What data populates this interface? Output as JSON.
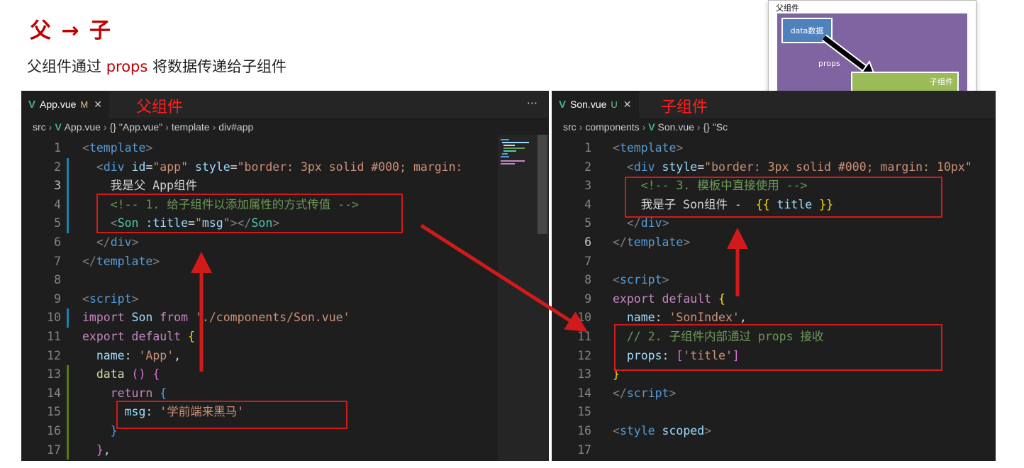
{
  "heading": "父 → 子",
  "subtitle": {
    "before": "父组件通过 ",
    "keyword": "props",
    "after": " 将数据传递给子组件"
  },
  "diagram": {
    "title": "父组件",
    "data_box": "data数据",
    "props_label": "props",
    "child_label": "子组件"
  },
  "left_editor": {
    "tab_file": "App.vue",
    "tab_status": "M",
    "tab_annotation": "父组件",
    "more": "···",
    "breadcrumb": [
      "src",
      "App.vue",
      "{} \"App.vue\"",
      "template",
      "div#app"
    ],
    "line_numbers": [
      "1",
      "2",
      "3",
      "4",
      "5",
      "6",
      "7",
      "8",
      "9",
      "10",
      "11",
      "12",
      "13",
      "14",
      "15",
      "16",
      "17"
    ],
    "lines": [
      [
        {
          "c": "t-br",
          "t": "<"
        },
        {
          "c": "t-tag",
          "t": "template"
        },
        {
          "c": "t-br",
          "t": ">"
        }
      ],
      [
        {
          "c": "t-txt",
          "t": "  "
        },
        {
          "c": "t-br",
          "t": "<"
        },
        {
          "c": "t-tag",
          "t": "div"
        },
        {
          "c": "t-attr",
          "t": " id"
        },
        {
          "c": "t-txt",
          "t": "="
        },
        {
          "c": "t-str",
          "t": "\"app\""
        },
        {
          "c": "t-attr",
          "t": " style"
        },
        {
          "c": "t-txt",
          "t": "="
        },
        {
          "c": "t-str",
          "t": "\"border: 3px solid #000; margin:"
        }
      ],
      [
        {
          "c": "t-txt",
          "t": "    我是父 App组件"
        }
      ],
      [
        {
          "c": "t-txt",
          "t": "    "
        },
        {
          "c": "t-com",
          "t": "<!-- 1. 给子组件以添加属性的方式传值 -->"
        }
      ],
      [
        {
          "c": "t-txt",
          "t": "    "
        },
        {
          "c": "t-br",
          "t": "<"
        },
        {
          "c": "t-comp",
          "t": "Son"
        },
        {
          "c": "t-attr",
          "t": " :title"
        },
        {
          "c": "t-txt",
          "t": "="
        },
        {
          "c": "t-str",
          "t": "\""
        },
        {
          "c": "t-var",
          "t": "msg"
        },
        {
          "c": "t-str",
          "t": "\""
        },
        {
          "c": "t-br",
          "t": "></"
        },
        {
          "c": "t-comp",
          "t": "Son"
        },
        {
          "c": "t-br",
          "t": ">"
        }
      ],
      [
        {
          "c": "t-txt",
          "t": "  "
        },
        {
          "c": "t-br",
          "t": "</"
        },
        {
          "c": "t-tag",
          "t": "div"
        },
        {
          "c": "t-br",
          "t": ">"
        }
      ],
      [
        {
          "c": "t-br",
          "t": "</"
        },
        {
          "c": "t-tag",
          "t": "template"
        },
        {
          "c": "t-br",
          "t": ">"
        }
      ],
      [],
      [
        {
          "c": "t-br",
          "t": "<"
        },
        {
          "c": "t-tag",
          "t": "script"
        },
        {
          "c": "t-br",
          "t": ">"
        }
      ],
      [
        {
          "c": "t-kw",
          "t": "import"
        },
        {
          "c": "t-var",
          "t": " Son"
        },
        {
          "c": "t-kw",
          "t": " from"
        },
        {
          "c": "t-str",
          "t": " './components/Son.vue'"
        }
      ],
      [
        {
          "c": "t-kw",
          "t": "export default"
        },
        {
          "c": "t-ylw",
          "t": " {"
        }
      ],
      [
        {
          "c": "t-var",
          "t": "  name"
        },
        {
          "c": "t-txt",
          "t": ": "
        },
        {
          "c": "t-str",
          "t": "'App'"
        },
        {
          "c": "t-txt",
          "t": ","
        }
      ],
      [
        {
          "c": "t-fn",
          "t": "  data"
        },
        {
          "c": "t-brk2",
          "t": " ()"
        },
        {
          "c": "t-brk2",
          "t": " {"
        }
      ],
      [
        {
          "c": "t-kw",
          "t": "    return"
        },
        {
          "c": "t-blue",
          "t": " {"
        }
      ],
      [
        {
          "c": "t-var",
          "t": "      msg"
        },
        {
          "c": "t-txt",
          "t": ": "
        },
        {
          "c": "t-str",
          "t": "'学前端来黑马'"
        }
      ],
      [
        {
          "c": "t-blue",
          "t": "    }"
        }
      ],
      [
        {
          "c": "t-brk2",
          "t": "  }"
        },
        {
          "c": "t-txt",
          "t": ","
        }
      ]
    ]
  },
  "right_editor": {
    "tab_file": "Son.vue",
    "tab_status": "U",
    "tab_annotation": "子组件",
    "breadcrumb": [
      "src",
      "components",
      "Son.vue",
      "{} \"Sc"
    ],
    "line_numbers": [
      "1",
      "2",
      "3",
      "4",
      "5",
      "6",
      "7",
      "8",
      "9",
      "10",
      "11",
      "12",
      "13",
      "14",
      "15",
      "16",
      "17"
    ],
    "lines": [
      [
        {
          "c": "t-br",
          "t": "<"
        },
        {
          "c": "t-tag",
          "t": "template"
        },
        {
          "c": "t-br",
          "t": ">"
        }
      ],
      [
        {
          "c": "t-txt",
          "t": "  "
        },
        {
          "c": "t-br",
          "t": "<"
        },
        {
          "c": "t-tag",
          "t": "div"
        },
        {
          "c": "t-attr",
          "t": " style"
        },
        {
          "c": "t-txt",
          "t": "="
        },
        {
          "c": "t-str",
          "t": "\"border: 3px solid #000; margin: 10px\""
        }
      ],
      [
        {
          "c": "t-txt",
          "t": "    "
        },
        {
          "c": "t-com",
          "t": "<!-- 3. 模板中直接使用 -->"
        }
      ],
      [
        {
          "c": "t-txt",
          "t": "    我是子 Son组件 -  "
        },
        {
          "c": "t-ylw",
          "t": "{{"
        },
        {
          "c": "t-var",
          "t": " title "
        },
        {
          "c": "t-ylw",
          "t": "}}"
        }
      ],
      [
        {
          "c": "t-txt",
          "t": "  "
        },
        {
          "c": "t-br",
          "t": "</"
        },
        {
          "c": "t-tag",
          "t": "div"
        },
        {
          "c": "t-br",
          "t": ">"
        }
      ],
      [
        {
          "c": "t-br",
          "t": "</"
        },
        {
          "c": "t-tag",
          "t": "template"
        },
        {
          "c": "t-br",
          "t": ">"
        }
      ],
      [],
      [
        {
          "c": "t-br",
          "t": "<"
        },
        {
          "c": "t-tag",
          "t": "script"
        },
        {
          "c": "t-br",
          "t": ">"
        }
      ],
      [
        {
          "c": "t-kw",
          "t": "export default"
        },
        {
          "c": "t-ylw",
          "t": " {"
        }
      ],
      [
        {
          "c": "t-var",
          "t": "  name"
        },
        {
          "c": "t-txt",
          "t": ": "
        },
        {
          "c": "t-str",
          "t": "'SonIndex'"
        },
        {
          "c": "t-txt",
          "t": ","
        }
      ],
      [
        {
          "c": "t-com",
          "t": "  // 2. 子组件内部通过 props 接收"
        }
      ],
      [
        {
          "c": "t-var",
          "t": "  props"
        },
        {
          "c": "t-txt",
          "t": ": "
        },
        {
          "c": "t-brk2",
          "t": "["
        },
        {
          "c": "t-str",
          "t": "'title'"
        },
        {
          "c": "t-brk2",
          "t": "]"
        }
      ],
      [
        {
          "c": "t-ylw",
          "t": "}"
        }
      ],
      [
        {
          "c": "t-br",
          "t": "</"
        },
        {
          "c": "t-tag",
          "t": "script"
        },
        {
          "c": "t-br",
          "t": ">"
        }
      ],
      [],
      [
        {
          "c": "t-br",
          "t": "<"
        },
        {
          "c": "t-tag",
          "t": "style"
        },
        {
          "c": "t-attr",
          "t": " scoped"
        },
        {
          "c": "t-br",
          "t": ">"
        }
      ],
      []
    ]
  }
}
